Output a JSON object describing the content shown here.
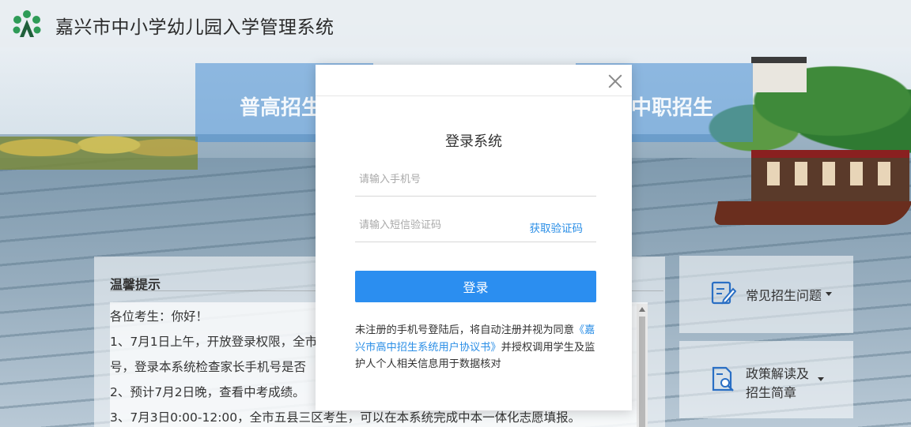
{
  "header": {
    "title": "嘉兴市中小学幼儿园入学管理系统"
  },
  "tiles": {
    "left_label": "普高招生",
    "right_label": "中职招生"
  },
  "notice": {
    "title": "温馨提示",
    "lines": [
      "各位考生：你好！",
      "1、7月1日上午，开放登录权限，全市",
      "号，登录本系统检查家长手机号是否",
      "2、预计7月2日晚，查看中考成绩。",
      "3、7月3日0:00-12:00，全市五县三区考生，可以在本系统完成中本一体化志愿填报。"
    ]
  },
  "side": {
    "faq_label": "常见招生问题",
    "policy_label_1": "政策解读及",
    "policy_label_2": "招生简章"
  },
  "modal": {
    "title": "登录系统",
    "phone_placeholder": "请输入手机号",
    "code_placeholder": "请输入短信验证码",
    "get_code_label": "获取验证码",
    "login_label": "登录",
    "agreement_prefix": "未注册的手机号登陆后，将自动注册并视为同意",
    "agreement_link": "《嘉兴市高中招生系统用户协议书》",
    "agreement_suffix": "并授权调用学生及监护人个人相关信息用于数据核对"
  },
  "colors": {
    "primary": "#2b8ef0",
    "link": "#2a8ee6",
    "logo_green": "#2e9b57"
  }
}
